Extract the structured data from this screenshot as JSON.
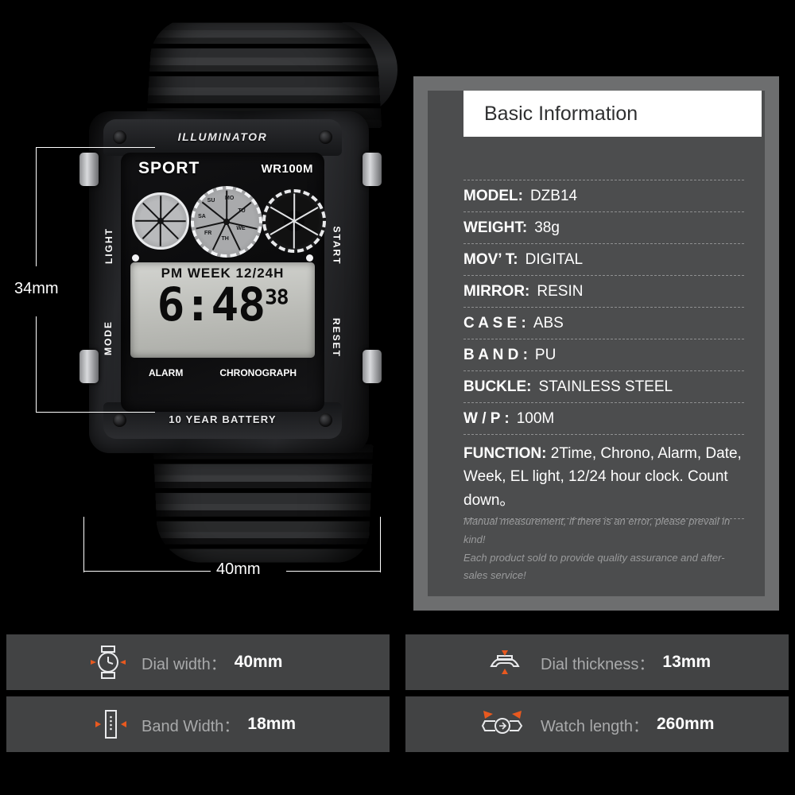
{
  "product_photo": {
    "bezel_top_text": "ILLUMINATOR",
    "bezel_bottom_text": "10 YEAR BATTERY",
    "dial": {
      "brand": "SPORT",
      "water_resistance": "WR100M",
      "left_upper_button": "LIGHT",
      "right_upper_button": "START",
      "left_lower_button": "MODE",
      "right_lower_button": "RESET",
      "alarm_label": "ALARM",
      "chronograph_label": "CHRONOGRAPH",
      "weekdays": [
        "MO",
        "TU",
        "WE",
        "TH",
        "FR",
        "SA",
        "SU"
      ],
      "lcd": {
        "indicator_row": "PM  WEEK  12/24H",
        "time": "6:48",
        "seconds": "38"
      }
    },
    "measurements": {
      "height": "34mm",
      "width": "40mm"
    }
  },
  "info_panel": {
    "title": "Basic Information",
    "specs": [
      {
        "key": "MODEL:",
        "value": "DZB14"
      },
      {
        "key": "WEIGHT:",
        "value": "38g"
      },
      {
        "key": "MOV’ T:",
        "value": "DIGITAL"
      },
      {
        "key": "MIRROR:",
        "value": "RESIN"
      },
      {
        "key": "C A S E :",
        "value": "ABS"
      },
      {
        "key": "B A N D :",
        "value": "PU"
      },
      {
        "key": "BUCKLE:",
        "value": "STAINLESS STEEL"
      },
      {
        "key": "W / P :",
        "value": "100M"
      }
    ],
    "function": {
      "key": "FUNCTION:",
      "value": "2Time, Chrono, Alarm, Date, Week, EL light, 12/24 hour clock. Count down。"
    },
    "notes": [
      "Manual measurement, if there is an error, please prevail in kind!",
      "Each product sold to provide quality assurance and after-sales service!"
    ]
  },
  "dimension_cards": [
    {
      "icon": "watch-dial-icon",
      "label": "Dial width：",
      "value": "40mm"
    },
    {
      "icon": "watch-profile-icon",
      "label": "Dial thickness：",
      "value": "13mm"
    },
    {
      "icon": "watch-band-icon",
      "label": "Band Width：",
      "value": "18mm"
    },
    {
      "icon": "watch-length-icon",
      "label": "Watch length：",
      "value": "260mm"
    }
  ],
  "colors": {
    "background": "#000000",
    "panel_outer": "#6d6e6f",
    "panel_inner": "#4c4d4e",
    "card": "#424344",
    "accent_orange": "#e8591f",
    "title_bar": "#ffffff"
  }
}
